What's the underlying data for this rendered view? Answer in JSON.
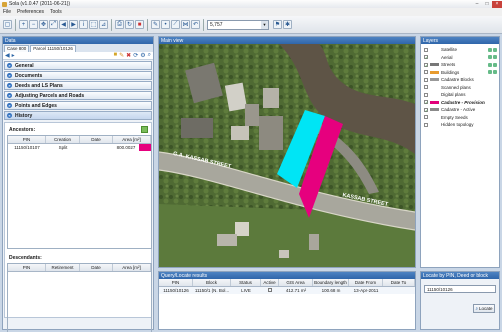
{
  "app": {
    "title": "Sola (v1.0.47 (2011-06-21))"
  },
  "menu": [
    "File",
    "Preferences",
    "Tools"
  ],
  "toolbar": {
    "scale_value": "5,757"
  },
  "data_panel": {
    "header": "Data",
    "tabs": [
      "Case 800",
      "Parcel 11150/10126"
    ],
    "sections": [
      "General",
      "Documents",
      "Deeds and LS Plans",
      "Adjusting Parcels and Roads",
      "Points and Edges",
      "History"
    ],
    "ancestors": {
      "label": "Ancestors:",
      "columns": [
        "PIN",
        "Creation",
        "Date",
        "Area [m²]"
      ],
      "rows": [
        [
          "11150/10107",
          "Split",
          "",
          "800.0027"
        ]
      ]
    },
    "descendants": {
      "label": "Descendants:",
      "columns": [
        "PIN",
        "Retirement",
        "Date",
        "Area [m²]"
      ],
      "rows": []
    }
  },
  "map": {
    "header": "Main view",
    "labels": {
      "road_left": "G.A. KASSAB STREET",
      "road_right": "KASSAB STREET"
    }
  },
  "layers": {
    "header": "Layers",
    "items": [
      {
        "label": "Satellite",
        "checked": false,
        "swatch": ""
      },
      {
        "label": "Aerial",
        "checked": true,
        "swatch": ""
      },
      {
        "label": "Streets",
        "checked": true,
        "swatch": "#777777"
      },
      {
        "label": "Buildings",
        "checked": false,
        "swatch": "#e89b2e"
      },
      {
        "label": "Cadastre Blocks",
        "checked": false,
        "swatch": "#999999"
      },
      {
        "label": "Scanned plans",
        "checked": false,
        "swatch": ""
      },
      {
        "label": "Digital plans",
        "checked": false,
        "swatch": ""
      },
      {
        "label": "Cadastre - Provisional",
        "checked": true,
        "swatch": "#e2007a",
        "bold": true
      },
      {
        "label": "Cadastre - Active",
        "checked": true,
        "swatch": "#8a8a8a"
      },
      {
        "label": "Empty Seeds",
        "checked": false,
        "swatch": ""
      },
      {
        "label": "Hidden topology",
        "checked": false,
        "swatch": ""
      }
    ]
  },
  "query": {
    "header": "Query/Locate results",
    "columns": [
      "PIN",
      "Block",
      "Status",
      "Active",
      "GIS Area",
      "Boundary length",
      "Date From",
      "Date To"
    ],
    "rows": [
      [
        "11150/10126",
        "11150/1 (N. Bol...",
        "LIVE",
        "",
        "412.71 m²",
        "100.68 m",
        "13-Apr-2011",
        ""
      ]
    ]
  },
  "locate": {
    "header": "Locate by PIN, Deed or block",
    "input_value": "11150/10126",
    "button_label": "Locate"
  },
  "colors": {
    "provisional": "#e6007e",
    "selected": "#00e5f5",
    "accent": "#3a6fb4"
  }
}
